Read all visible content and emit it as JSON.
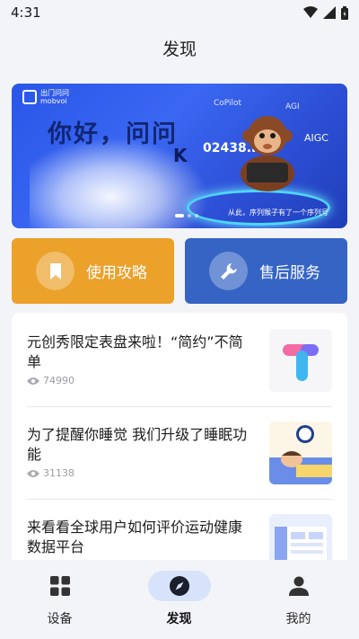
{
  "status_bar": {
    "time": "4:31",
    "icons": [
      "wifi-icon",
      "signal-icon",
      "battery-icon"
    ]
  },
  "header": {
    "title": "发现"
  },
  "banner": {
    "logo_text": "出门问问",
    "logo_subtext": "mobvoi",
    "headline": "你好，问问",
    "tags": [
      "CoPilot",
      "AGI",
      "AIGC"
    ],
    "stock_code": "02438.HK",
    "caption": "从此，序列猴子有了一个序列号",
    "slides_count": 3,
    "active_slide": 1
  },
  "actions": [
    {
      "label": "使用攻略",
      "icon": "bookmark-icon",
      "color": "#eba12a"
    },
    {
      "label": "售后服务",
      "icon": "wrench-icon",
      "color": "#3564c4"
    }
  ],
  "articles": [
    {
      "title": "元创秀限定表盘来啦！“简约”不简单",
      "views": "74990",
      "thumb": "t-logo-thumbnail"
    },
    {
      "title": "为了提醒你睡觉 我们升级了睡眠功能",
      "views": "31138",
      "thumb": "sleeping-person-thumbnail"
    },
    {
      "title": "来看看全球用户如何评价运动健康数据平台",
      "views": "",
      "thumb": "dashboard-thumbnail"
    }
  ],
  "bottom_nav": [
    {
      "label": "设备",
      "icon": "grid-icon",
      "active": false
    },
    {
      "label": "发现",
      "icon": "compass-icon",
      "active": true
    },
    {
      "label": "我的",
      "icon": "person-icon",
      "active": false
    }
  ],
  "colors": {
    "accent_blue": "#3564c4",
    "accent_orange": "#eba12a",
    "nav_active_bg": "#d7e3fa"
  }
}
